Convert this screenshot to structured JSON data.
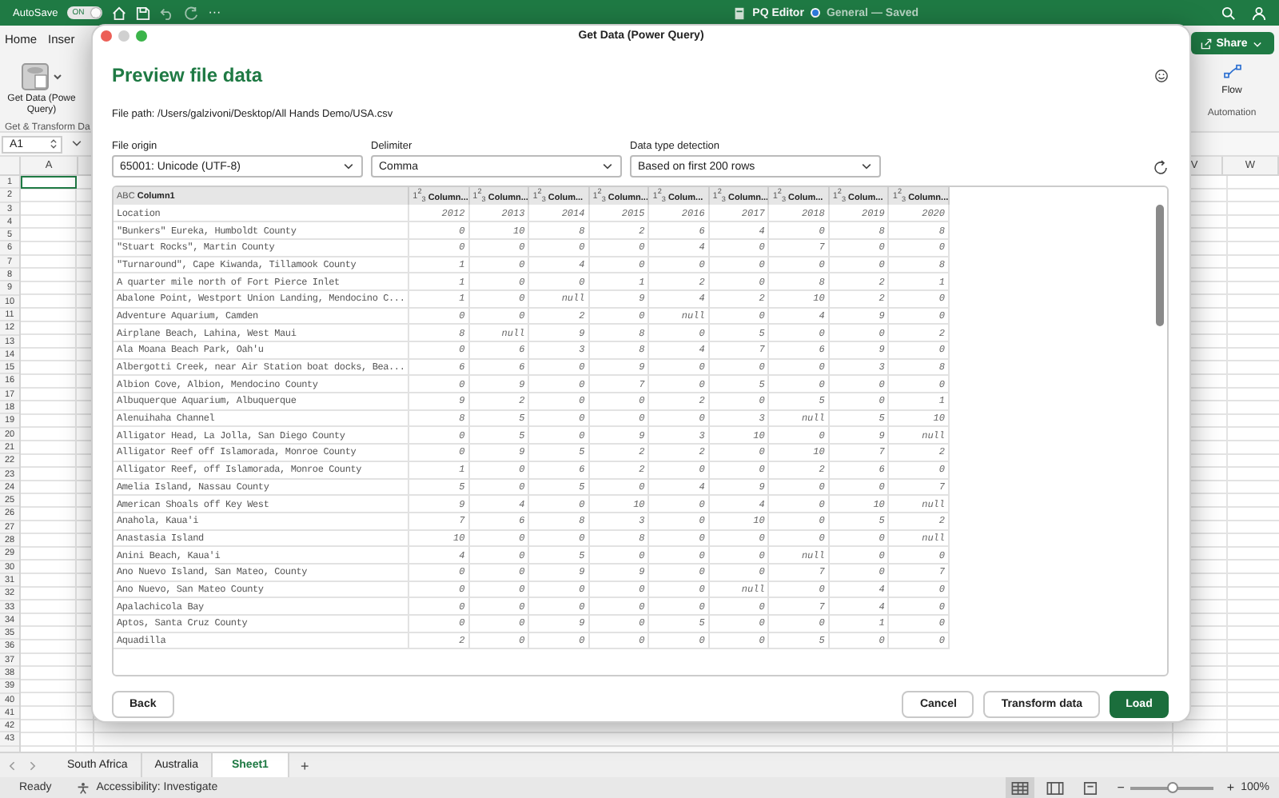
{
  "app_bar": {
    "autosave_label": "AutoSave",
    "autosave_toggle": {
      "label": "ON",
      "on": true
    },
    "more": "···",
    "document_title": "PQ Editor",
    "location": "General — Saved"
  },
  "ribbon": {
    "tabs": [
      {
        "label": "Home",
        "selected": false
      },
      {
        "label": "Inser",
        "selected": false
      }
    ],
    "get_data": "Get Data (Powe Query)",
    "group_left": "Get & Transform Da",
    "share_button": "Share",
    "flow": "Flow",
    "group_right": "Automation"
  },
  "formula_bar": {
    "name_box": "A1"
  },
  "sheet": {
    "columns_left": [
      "A"
    ],
    "columns_right": [
      "V",
      "W"
    ],
    "row_numbers": [
      "1",
      "2",
      "3",
      "4",
      "5",
      "6",
      "7",
      "8",
      "9",
      "10",
      "11",
      "12",
      "13",
      "14",
      "15",
      "16",
      "17",
      "18",
      "19",
      "20",
      "21",
      "22",
      "23",
      "24",
      "25",
      "26",
      "27",
      "28",
      "29",
      "30",
      "31",
      "32",
      "33",
      "34",
      "35",
      "36",
      "37",
      "38",
      "39",
      "40",
      "41",
      "42",
      "43"
    ],
    "a1_selected": true
  },
  "dialog": {
    "title": "Get Data (Power Query)",
    "heading": "Preview file data",
    "file_path": "File path: /Users/galzivoni/Desktop/All Hands Demo/USA.csv",
    "options": [
      {
        "label": "File origin",
        "value": "65001: Unicode (UTF-8)"
      },
      {
        "label": "Delimiter",
        "value": "Comma"
      },
      {
        "label": "Data type detection",
        "value": "Based on first 200 rows"
      }
    ],
    "table": {
      "columns": [
        {
          "kind": "text",
          "type_label": "ABC",
          "name": "Column1"
        },
        {
          "kind": "number",
          "type_label": "1$^{2}$$_{3}$",
          "name": "Column..."
        },
        {
          "kind": "number",
          "type_label": "1$^{2}$$_{3}$",
          "name": "Column..."
        },
        {
          "kind": "number",
          "type_label": "1$^{2}$$_{3}$",
          "name": "Colum..."
        },
        {
          "kind": "number",
          "type_label": "1$^{2}$$_{3}$",
          "name": "Column..."
        },
        {
          "kind": "number",
          "type_label": "1$^{2}$$_{3}$",
          "name": "Colum..."
        },
        {
          "kind": "number",
          "type_label": "1$^{2}$$_{3}$",
          "name": "Column..."
        },
        {
          "kind": "number",
          "type_label": "1$^{2}$$_{3}$",
          "name": "Colum..."
        },
        {
          "kind": "number",
          "type_label": "1$^{2}$$_{3}$",
          "name": "Colum..."
        },
        {
          "kind": "number",
          "type_label": "1$^{2}$$_{3}$",
          "name": "Column..."
        }
      ],
      "rows": [
        [
          "Location",
          "2012",
          "2013",
          "2014",
          "2015",
          "2016",
          "2017",
          "2018",
          "2019",
          "2020"
        ],
        [
          "\"Bunkers\" Eureka, Humboldt County",
          "0",
          "10",
          "8",
          "2",
          "6",
          "4",
          "0",
          "8",
          "8"
        ],
        [
          "\"Stuart Rocks\", Martin County",
          "0",
          "0",
          "0",
          "0",
          "4",
          "0",
          "7",
          "0",
          "0"
        ],
        [
          "\"Turnaround\", Cape Kiwanda, Tillamook County",
          "1",
          "0",
          "4",
          "0",
          "0",
          "0",
          "0",
          "0",
          "8"
        ],
        [
          "A quarter mile north of Fort Pierce Inlet",
          "1",
          "0",
          "0",
          "1",
          "2",
          "0",
          "8",
          "2",
          "1"
        ],
        [
          "Abalone Point, Westport Union Landing, Mendocino C...",
          "1",
          "0",
          "null",
          "9",
          "4",
          "2",
          "10",
          "2",
          "0"
        ],
        [
          "Adventure Aquarium, Camden",
          "0",
          "0",
          "2",
          "0",
          "null",
          "0",
          "4",
          "9",
          "0"
        ],
        [
          "Airplane Beach, Lahina, West Maui",
          "8",
          "null",
          "9",
          "8",
          "0",
          "5",
          "0",
          "0",
          "2"
        ],
        [
          "Ala Moana Beach Park, Oah'u",
          "0",
          "6",
          "3",
          "8",
          "4",
          "7",
          "6",
          "9",
          "0"
        ],
        [
          "Albergotti Creek, near Air Station boat docks, Bea...",
          "6",
          "6",
          "0",
          "9",
          "0",
          "0",
          "0",
          "3",
          "8"
        ],
        [
          "Albion Cove, Albion, Mendocino County",
          "0",
          "9",
          "0",
          "7",
          "0",
          "5",
          "0",
          "0",
          "0"
        ],
        [
          "Albuquerque Aquarium, Albuquerque",
          "9",
          "2",
          "0",
          "0",
          "2",
          "0",
          "5",
          "0",
          "1"
        ],
        [
          "Alenuihaha Channel",
          "8",
          "5",
          "0",
          "0",
          "0",
          "3",
          "null",
          "5",
          "10"
        ],
        [
          "Alligator Head, La Jolla, San Diego County",
          "0",
          "5",
          "0",
          "9",
          "3",
          "10",
          "0",
          "9",
          "null"
        ],
        [
          "Alligator Reef off Islamorada, Monroe County",
          "0",
          "9",
          "5",
          "2",
          "2",
          "0",
          "10",
          "7",
          "2"
        ],
        [
          "Alligator Reef, off Islamorada, Monroe County",
          "1",
          "0",
          "6",
          "2",
          "0",
          "0",
          "2",
          "6",
          "0"
        ],
        [
          "Amelia Island, Nassau County",
          "5",
          "0",
          "5",
          "0",
          "4",
          "9",
          "0",
          "0",
          "7"
        ],
        [
          "American Shoals off Key West",
          "9",
          "4",
          "0",
          "10",
          "0",
          "4",
          "0",
          "10",
          "null"
        ],
        [
          "Anahola, Kaua'i",
          "7",
          "6",
          "8",
          "3",
          "0",
          "10",
          "0",
          "5",
          "2"
        ],
        [
          "Anastasia Island",
          "10",
          "0",
          "0",
          "8",
          "0",
          "0",
          "0",
          "0",
          "null"
        ],
        [
          "Anini Beach, Kaua'i",
          "4",
          "0",
          "5",
          "0",
          "0",
          "0",
          "null",
          "0",
          "0"
        ],
        [
          "Ano Nuevo Island, San Mateo, County",
          "0",
          "0",
          "9",
          "9",
          "0",
          "0",
          "7",
          "0",
          "7"
        ],
        [
          "Ano Nuevo, San Mateo County",
          "0",
          "0",
          "0",
          "0",
          "0",
          "null",
          "0",
          "4",
          "0"
        ],
        [
          "Apalachicola Bay",
          "0",
          "0",
          "0",
          "0",
          "0",
          "0",
          "7",
          "4",
          "0"
        ],
        [
          "Aptos, Santa Cruz County",
          "0",
          "0",
          "9",
          "0",
          "5",
          "0",
          "0",
          "1",
          "0"
        ],
        [
          "Aquadilla",
          "2",
          "0",
          "0",
          "0",
          "0",
          "0",
          "5",
          "0",
          "0"
        ]
      ]
    },
    "buttons": {
      "back": "Back",
      "cancel": "Cancel",
      "transform": "Transform data",
      "load": "Load"
    }
  },
  "sheet_tabs": [
    {
      "label": "South Africa",
      "selected": false
    },
    {
      "label": "Australia",
      "selected": false
    },
    {
      "label": "Sheet1",
      "selected": true
    }
  ],
  "add_sheet": "+",
  "status_bar": {
    "status": "Ready",
    "accessibility": "Accessibility: Investigate",
    "zoom_minus": "−",
    "zoom": {
      "level": 0.5
    },
    "zoom_plus": "+",
    "zoom_value": "100%"
  }
}
